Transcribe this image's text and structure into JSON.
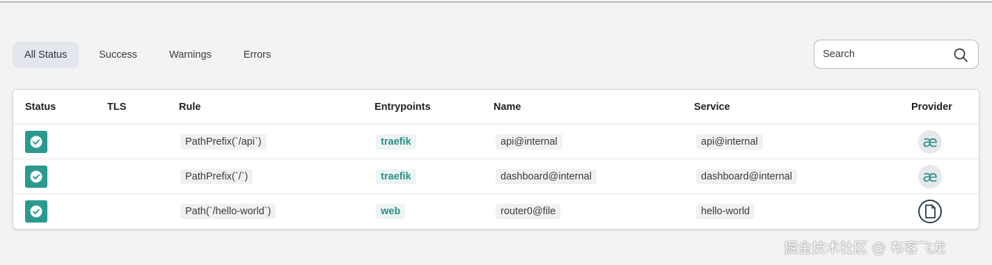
{
  "filters": {
    "tabs": [
      {
        "label": "All Status",
        "active": true
      },
      {
        "label": "Success",
        "active": false
      },
      {
        "label": "Warnings",
        "active": false
      },
      {
        "label": "Errors",
        "active": false
      }
    ]
  },
  "search": {
    "placeholder": "Search",
    "icon": "search-icon"
  },
  "table": {
    "columns": [
      "Status",
      "TLS",
      "Rule",
      "Entrypoints",
      "Name",
      "Service",
      "Provider"
    ],
    "rows": [
      {
        "status": "success",
        "tls": "",
        "rule": "PathPrefix(`/api`)",
        "entrypoint": "traefik",
        "name": "api@internal",
        "service": "api@internal",
        "provider_icon": "internal-provider-icon"
      },
      {
        "status": "success",
        "tls": "",
        "rule": "PathPrefix(`/`)",
        "entrypoint": "traefik",
        "name": "dashboard@internal",
        "service": "dashboard@internal",
        "provider_icon": "internal-provider-icon"
      },
      {
        "status": "success",
        "tls": "",
        "rule": "Path(`/hello-world`)",
        "entrypoint": "web",
        "name": "router0@file",
        "service": "hello-world",
        "provider_icon": "file-provider-icon"
      }
    ]
  },
  "colors": {
    "accent": "#2a9a91",
    "active_tab_bg": "#e3e6ec"
  },
  "watermark": "掘金技术社区 @ 布客飞龙"
}
